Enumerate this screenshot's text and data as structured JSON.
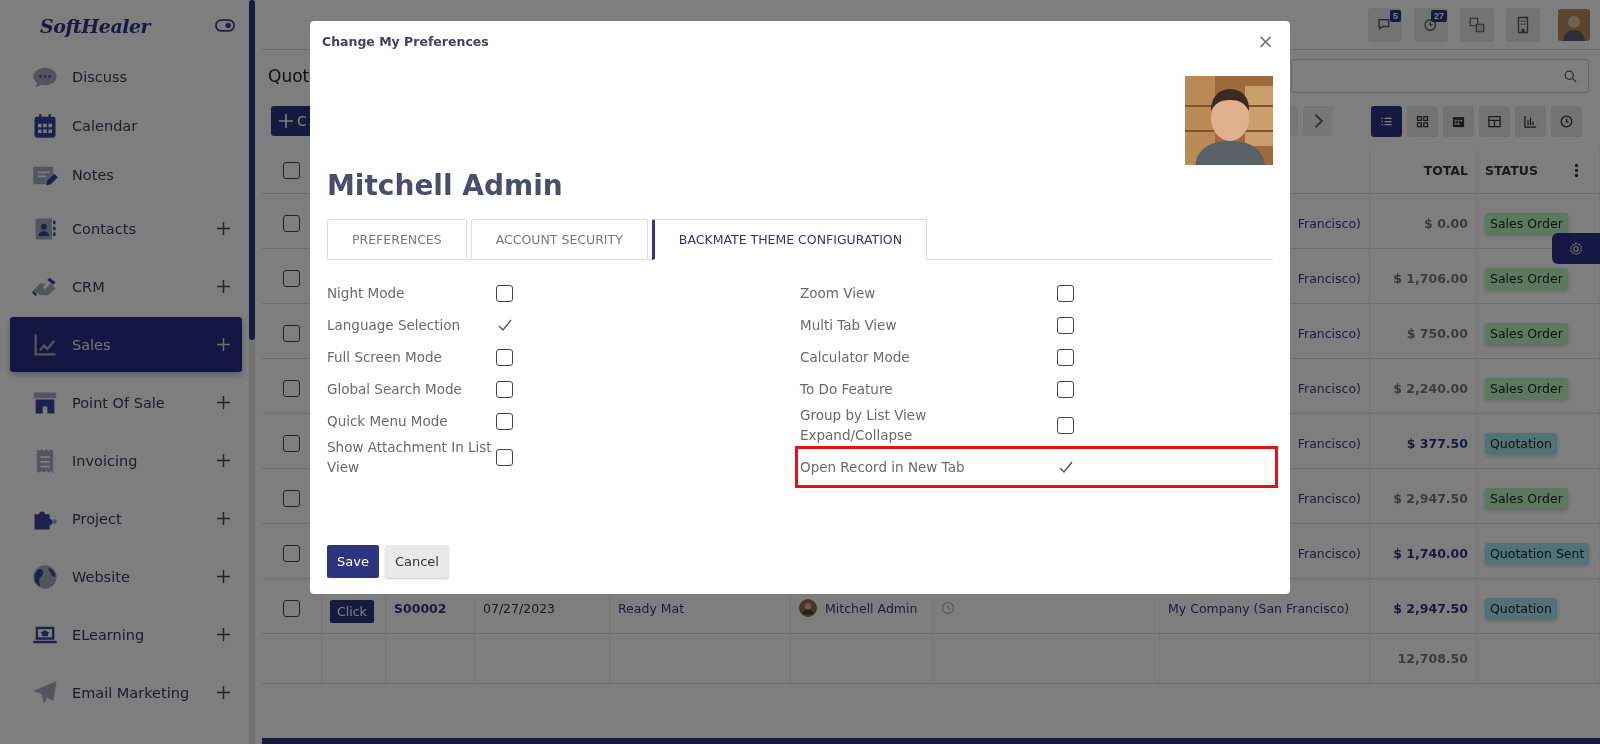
{
  "sidebar": {
    "logo": "SoftHealer",
    "items": [
      {
        "label": "Discuss",
        "selected": false,
        "expandable": false
      },
      {
        "label": "Calendar",
        "selected": false,
        "expandable": false
      },
      {
        "label": "Notes",
        "selected": false,
        "expandable": false
      },
      {
        "label": "Contacts",
        "selected": false,
        "expandable": true
      },
      {
        "label": "CRM",
        "selected": false,
        "expandable": true
      },
      {
        "label": "Sales",
        "selected": true,
        "expandable": true
      },
      {
        "label": "Point Of Sale",
        "selected": false,
        "expandable": true
      },
      {
        "label": "Invoicing",
        "selected": false,
        "expandable": true
      },
      {
        "label": "Project",
        "selected": false,
        "expandable": true
      },
      {
        "label": "Website",
        "selected": false,
        "expandable": true
      },
      {
        "label": "ELearning",
        "selected": false,
        "expandable": true
      },
      {
        "label": "Email Marketing",
        "selected": false,
        "expandable": true
      }
    ]
  },
  "topbar": {
    "badges": [
      "5",
      "27"
    ]
  },
  "page": {
    "title": "Quot",
    "new_button": "C"
  },
  "table": {
    "select_all_checked": false,
    "columns": [
      "TOTAL",
      "STATUS"
    ],
    "rows": [
      {
        "checked": false,
        "company": "Francisco)",
        "total": "$ 0.00",
        "status": "Sales Order",
        "kind": "sales_order"
      },
      {
        "checked": false,
        "company": "Francisco)",
        "total": "$ 1,706.00",
        "status": "Sales Order",
        "kind": "sales_order"
      },
      {
        "checked": false,
        "company": "Francisco)",
        "total": "$ 750.00",
        "status": "Sales Order",
        "kind": "sales_order"
      },
      {
        "checked": false,
        "company": "Francisco)",
        "total": "$ 2,240.00",
        "status": "Sales Order",
        "kind": "sales_order"
      },
      {
        "checked": false,
        "company": "Francisco)",
        "total": "$ 377.50",
        "status": "Quotation",
        "kind": "quotation"
      },
      {
        "checked": false,
        "company": "Francisco)",
        "total": "$ 2,947.50",
        "status": "Sales Order",
        "kind": "sales_order"
      },
      {
        "checked": false,
        "company": "Francisco)",
        "total": "$ 1,740.00",
        "status": "Quotation Sent",
        "kind": "quotation"
      },
      {
        "checked": false,
        "button": "Click",
        "number": "S00002",
        "date": "07/27/2023",
        "customer": "Ready Mat",
        "salesperson": "Mitchell Admin",
        "company": "My Company (San Francisco)",
        "total": "$ 2,947.50",
        "status": "Quotation",
        "kind": "quotation"
      }
    ],
    "footer_total": "12,708.50"
  },
  "dialog": {
    "title": "Change My Preferences",
    "close": "×",
    "user_name": "Mitchell Admin",
    "tabs": [
      {
        "label": "PREFERENCES",
        "selected": false
      },
      {
        "label": "ACCOUNT SECURITY",
        "selected": false
      },
      {
        "label": "BACKMATE THEME CONFIGURATION",
        "selected": true
      }
    ],
    "settings": {
      "left": [
        {
          "label": "Night Mode",
          "checked": false,
          "highlighted": false
        },
        {
          "label": "Language Selection",
          "checked": true,
          "highlighted": false
        },
        {
          "label": "Full Screen Mode",
          "checked": false,
          "highlighted": false
        },
        {
          "label": "Global Search Mode",
          "checked": false,
          "highlighted": false
        },
        {
          "label": "Quick Menu Mode",
          "checked": false,
          "highlighted": false
        },
        {
          "label": "Show Attachment In List View",
          "checked": false,
          "highlighted": false
        }
      ],
      "right": [
        {
          "label": "Zoom View",
          "checked": false,
          "highlighted": false
        },
        {
          "label": "Multi Tab View",
          "checked": false,
          "highlighted": false
        },
        {
          "label": "Calculator Mode",
          "checked": false,
          "highlighted": false
        },
        {
          "label": "To Do Feature",
          "checked": false,
          "highlighted": false
        },
        {
          "label": "Group by List View Expand/Collapse",
          "checked": false,
          "highlighted": false
        },
        {
          "label": "Open Record in New Tab",
          "checked": true,
          "highlighted": true
        }
      ]
    },
    "buttons": [
      {
        "label": "Save",
        "kind": "primary"
      },
      {
        "label": "Cancel",
        "kind": "secondary"
      }
    ]
  }
}
